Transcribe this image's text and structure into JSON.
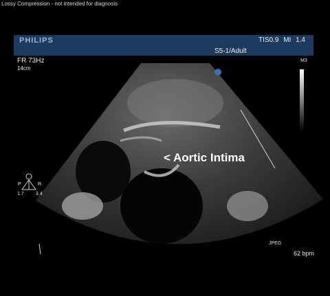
{
  "header": {
    "lossy_notice": "Lossy Compression - not intended for diagnosis",
    "brand": "PHILIPS",
    "tis_mi": "TIS0.9  MI 1.4",
    "probe": "S5-1/Adult"
  },
  "left_readout": {
    "frame_rate": "FR 73Hz",
    "depth": "14cm"
  },
  "right_readout": {
    "map": "M3",
    "jpeg": "JPEG",
    "heart_rate": "62 bpm"
  },
  "annotation": "< Aortic Intima",
  "orientation": {
    "left_letter": "P",
    "right_letter": "R",
    "left_value": "1.7",
    "right_value": "3.4",
    "marker": "3"
  },
  "colors": {
    "header_bar": "#1c3a5e",
    "background": "#000000",
    "text": "#e8e8e8"
  }
}
